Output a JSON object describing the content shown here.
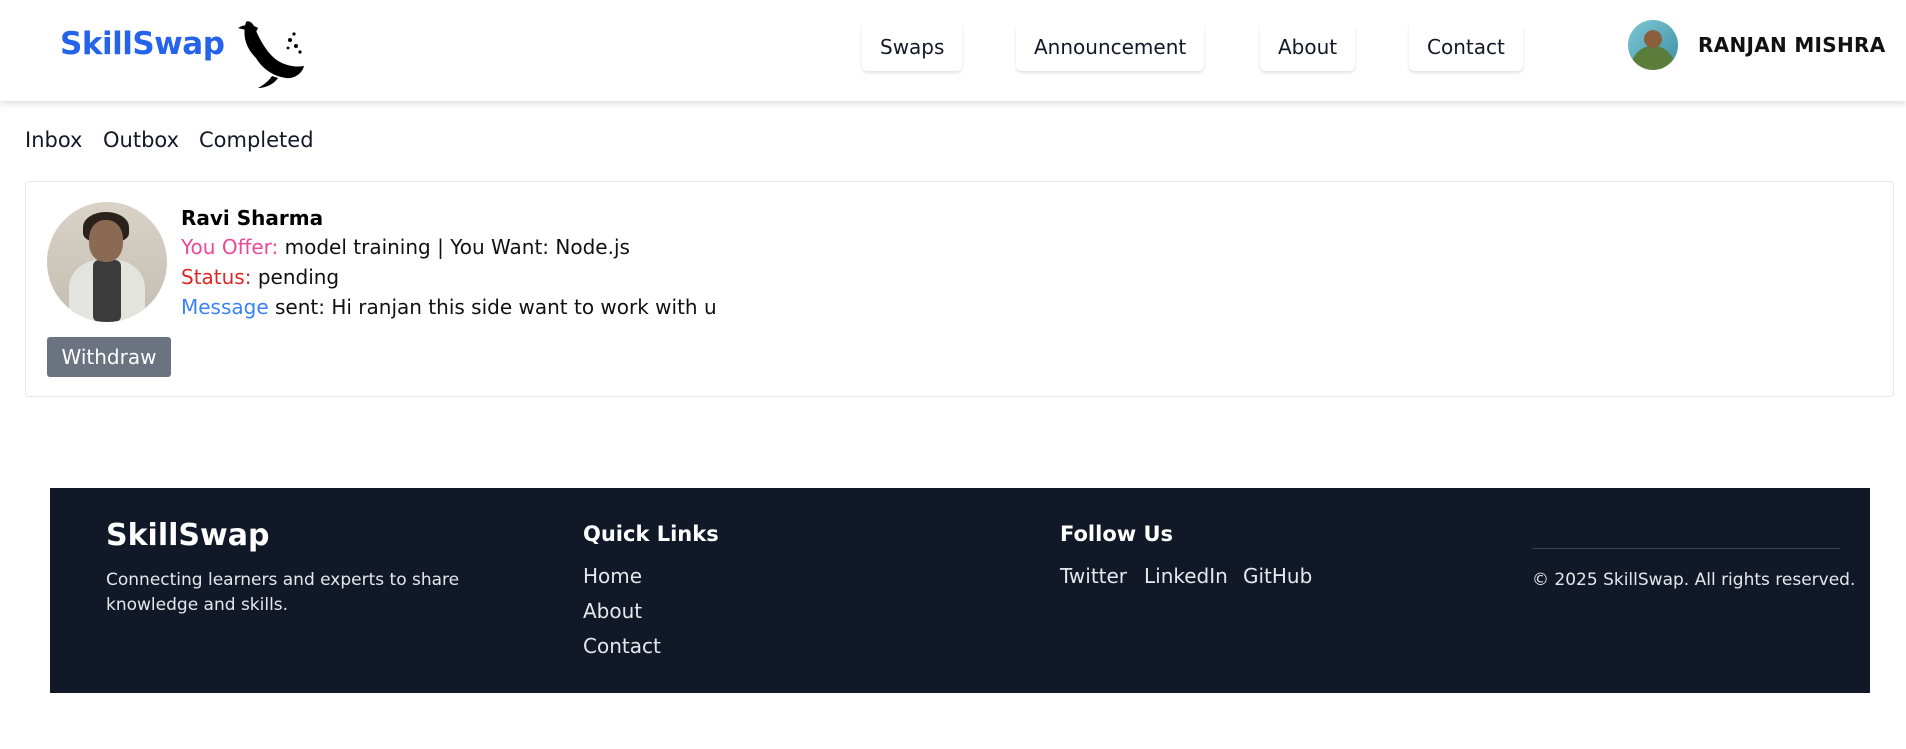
{
  "header": {
    "brand": "SkillSwap",
    "nav": [
      "Swaps",
      "Announcement",
      "About",
      "Contact"
    ],
    "user_name": "RANJAN MISHRA"
  },
  "tabs": [
    "Inbox",
    "Outbox",
    "Completed"
  ],
  "request": {
    "name": "Ravi Sharma",
    "offer_label": "You Offer:",
    "offer_value": "model training",
    "want_label": "| You Want:",
    "want_value": "Node.js",
    "status_label": "Status:",
    "status_value": "pending",
    "message_label": "Message",
    "message_value": "sent: Hi ranjan this side want to work with u",
    "withdraw_label": "Withdraw"
  },
  "footer": {
    "brand": "SkillSwap",
    "tagline": "Connecting learners and experts to share knowledge and skills.",
    "quick_links_title": "Quick Links",
    "quick_links": [
      "Home",
      "About",
      "Contact"
    ],
    "follow_title": "Follow Us",
    "social": [
      "Twitter",
      "LinkedIn",
      "GitHub"
    ],
    "copyright": "© 2025 SkillSwap. All rights reserved."
  },
  "colors": {
    "brand": "#2563eb",
    "offer": "#ec4899",
    "status": "#dc2626",
    "message": "#3b82f6",
    "footer_bg": "#111827",
    "button_bg": "#6b7280"
  },
  "icons": {
    "logo": "whale-icon"
  }
}
